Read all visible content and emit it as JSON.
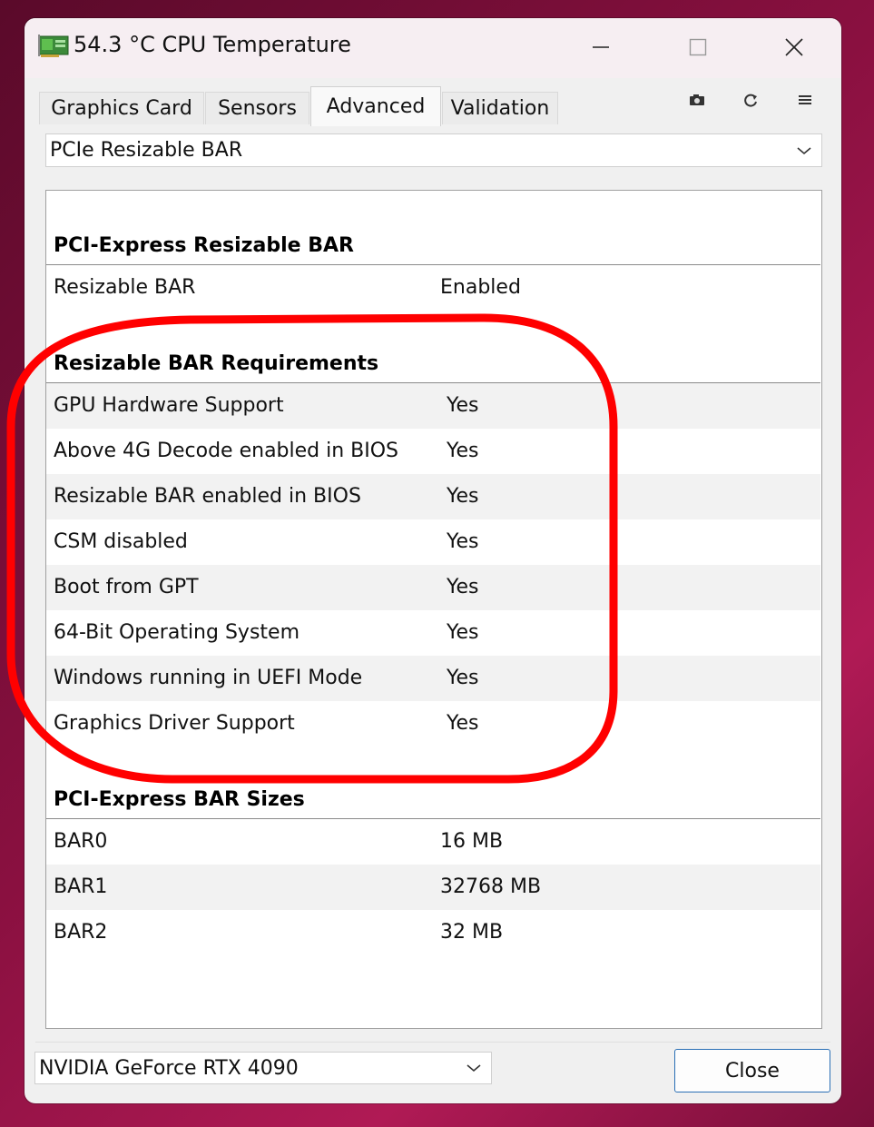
{
  "window": {
    "title": "54.3 °C CPU Temperature",
    "icon": "graphics-card-icon",
    "controls": [
      "minimize-icon",
      "maximize-icon",
      "close-icon"
    ]
  },
  "tabs": [
    {
      "label": "Graphics Card",
      "active": false
    },
    {
      "label": "Sensors",
      "active": false
    },
    {
      "label": "Advanced",
      "active": true
    },
    {
      "label": "Validation",
      "active": false
    }
  ],
  "toolbar_icons": [
    "camera-icon",
    "refresh-icon",
    "menu-icon"
  ],
  "section_select": {
    "value": "PCIe Resizable BAR"
  },
  "sections": {
    "pcie_rebar": {
      "title": "PCI-Express Resizable BAR",
      "rows": [
        {
          "label": "Resizable BAR",
          "value": "Enabled"
        }
      ]
    },
    "requirements": {
      "title": "Resizable BAR Requirements",
      "rows": [
        {
          "label": "GPU Hardware Support",
          "value": "Yes"
        },
        {
          "label": "Above 4G Decode enabled in BIOS",
          "value": "Yes"
        },
        {
          "label": "Resizable BAR enabled in BIOS",
          "value": "Yes"
        },
        {
          "label": "CSM disabled",
          "value": "Yes"
        },
        {
          "label": "Boot from GPT",
          "value": "Yes"
        },
        {
          "label": "64-Bit Operating System",
          "value": "Yes"
        },
        {
          "label": "Windows running in UEFI Mode",
          "value": "Yes"
        },
        {
          "label": "Graphics Driver Support",
          "value": "Yes"
        }
      ]
    },
    "bar_sizes": {
      "title": "PCI-Express BAR Sizes",
      "rows": [
        {
          "label": "BAR0",
          "value": "16 MB"
        },
        {
          "label": "BAR1",
          "value": "32768 MB"
        },
        {
          "label": "BAR2",
          "value": "32 MB"
        }
      ]
    }
  },
  "gpu_select": {
    "value": "NVIDIA GeForce RTX 4090"
  },
  "close_button": {
    "label": "Close"
  },
  "colors": {
    "highlight_ring": "#ff0000",
    "close_button_border": "#2a6fb5",
    "title_bar": "#f6eef2"
  }
}
